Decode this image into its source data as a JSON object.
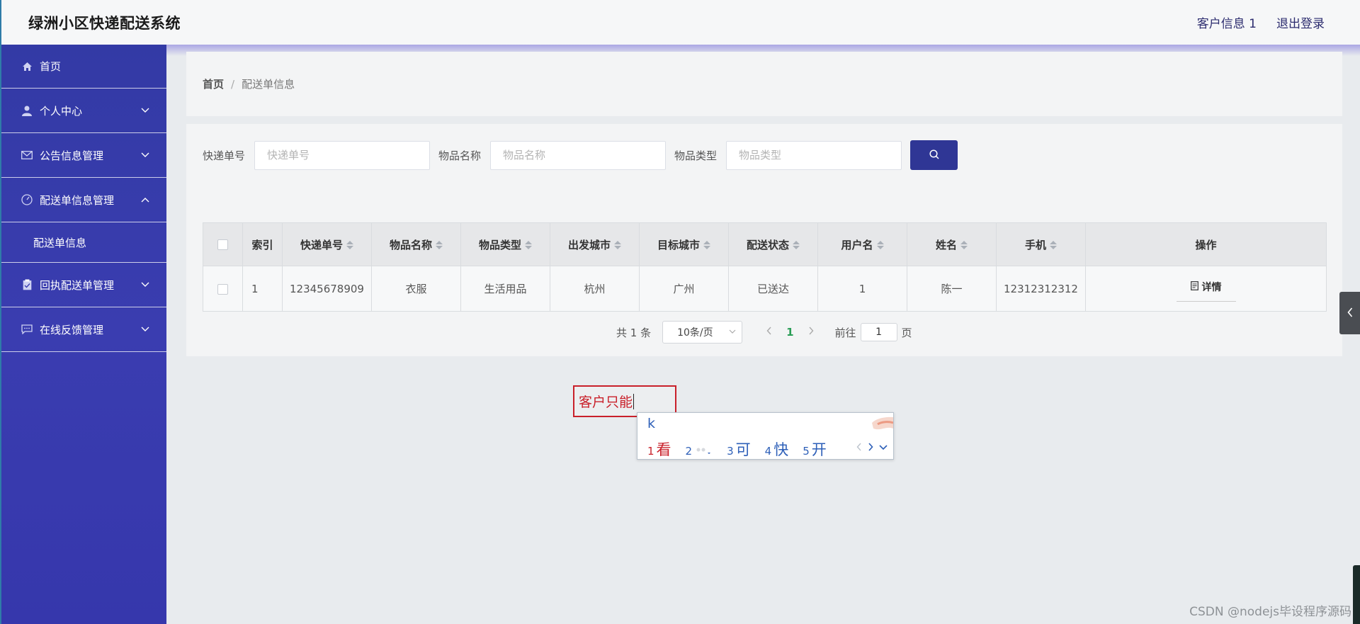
{
  "header": {
    "title": "绿洲小区快递配送系统",
    "user": "客户信息 1",
    "logout": "退出登录"
  },
  "sidebar": {
    "items": [
      {
        "label": "首页"
      },
      {
        "label": "个人中心"
      },
      {
        "label": "公告信息管理"
      },
      {
        "label": "配送单信息管理"
      },
      {
        "label": "配送单信息"
      },
      {
        "label": "回执配送单管理"
      },
      {
        "label": "在线反馈管理"
      }
    ]
  },
  "breadcrumb": {
    "home": "首页",
    "sep": "/",
    "current": "配送单信息"
  },
  "search": {
    "f1_label": "快递单号",
    "f1_placeholder": "快递单号",
    "f2_label": "物品名称",
    "f2_placeholder": "物品名称",
    "f3_label": "物品类型",
    "f3_placeholder": "物品类型"
  },
  "table": {
    "headers": [
      "索引",
      "快递单号",
      "物品名称",
      "物品类型",
      "出发城市",
      "目标城市",
      "配送状态",
      "用户名",
      "姓名",
      "手机",
      "操作"
    ],
    "rows": [
      [
        "1",
        "12345678909",
        "衣服",
        "生活用品",
        "杭州",
        "广州",
        "已送达",
        "1",
        "陈一",
        "12312312312"
      ]
    ],
    "detail_label": "详情"
  },
  "pager": {
    "total": "共 1 条",
    "page_size": "10条/页",
    "current_page": "1",
    "goto_prefix": "前往",
    "goto_value": "1",
    "goto_suffix": "页"
  },
  "annotation": {
    "text": "客户只能"
  },
  "ime": {
    "composition": "k",
    "candidates": [
      {
        "n": "1",
        "t": "看"
      },
      {
        "n": "3",
        "t": "可"
      },
      {
        "n": "4",
        "t": "快"
      },
      {
        "n": "5",
        "t": "开"
      }
    ],
    "emoji_index": "2"
  },
  "watermark": "CSDN @nodejs毕设程序源码"
}
